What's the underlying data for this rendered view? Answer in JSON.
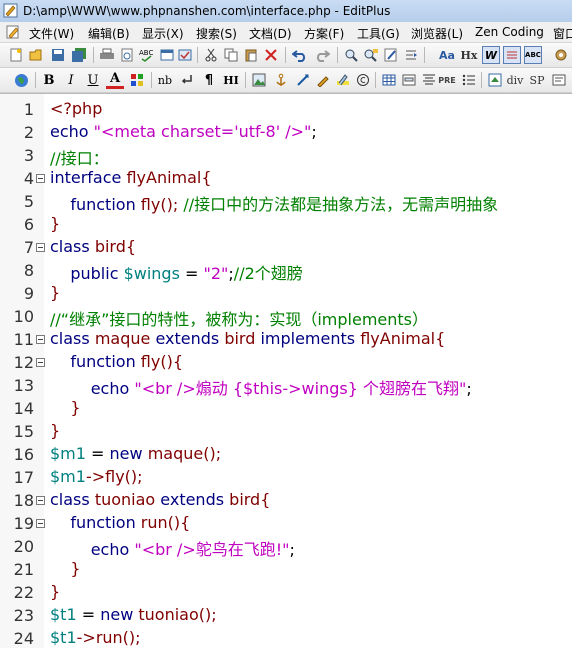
{
  "window": {
    "title": "D:\\amp\\WWW\\www.phpnanshen.com\\interface.php - EditPlus"
  },
  "menu": [
    "文件(W)",
    "编辑(B)",
    "显示(X)",
    "搜索(S)",
    "文档(D)",
    "方案(F)",
    "工具(G)",
    "浏览器(L)",
    "Zen Coding",
    "窗口"
  ],
  "toolbar2_labels": {
    "bold": "B",
    "italic": "I",
    "underline": "U",
    "font": "A",
    "nb": "nb",
    "para": "¶",
    "hi": "HI",
    "hx": "Hx",
    "pre": "PRE",
    "div": "div",
    "sp": "SP"
  },
  "colors": {
    "keyword": "#000080",
    "string": "#c000c0",
    "comment": "#008000",
    "variable": "#008080",
    "identifier": "#800000"
  },
  "code_lines": [
    {
      "n": "1",
      "fold": false,
      "indent": "",
      "tokens": [
        {
          "t": "<?php",
          "c": "p"
        }
      ]
    },
    {
      "n": "2",
      "fold": false,
      "indent": "",
      "tokens": [
        {
          "t": "echo ",
          "c": "k"
        },
        {
          "t": "\"<meta charset='utf-8' />\"",
          "c": "s"
        },
        {
          "t": ";",
          "c": "d"
        }
      ]
    },
    {
      "n": "3",
      "fold": false,
      "indent": "",
      "tokens": [
        {
          "t": "//接口：",
          "c": "c"
        }
      ]
    },
    {
      "n": "4",
      "fold": true,
      "indent": "",
      "tokens": [
        {
          "t": "interface ",
          "c": "k"
        },
        {
          "t": "flyAnimal{",
          "c": "p"
        }
      ]
    },
    {
      "n": "5",
      "fold": false,
      "indent": "    ",
      "tokens": [
        {
          "t": "function ",
          "c": "k"
        },
        {
          "t": "fly(); ",
          "c": "p"
        },
        {
          "t": "//接口中的方法都是抽象方法，无需声明抽象",
          "c": "c"
        }
      ]
    },
    {
      "n": "6",
      "fold": false,
      "indent": "",
      "tokens": [
        {
          "t": "}",
          "c": "p"
        }
      ]
    },
    {
      "n": "7",
      "fold": true,
      "indent": "",
      "tokens": [
        {
          "t": "class ",
          "c": "k"
        },
        {
          "t": "bird{",
          "c": "p"
        }
      ]
    },
    {
      "n": "8",
      "fold": false,
      "indent": "    ",
      "tokens": [
        {
          "t": "public ",
          "c": "k"
        },
        {
          "t": "$wings",
          "c": "v"
        },
        {
          "t": " = ",
          "c": "d"
        },
        {
          "t": "\"2\"",
          "c": "s"
        },
        {
          "t": ";",
          "c": "d"
        },
        {
          "t": "//2个翅膀",
          "c": "c"
        }
      ]
    },
    {
      "n": "9",
      "fold": false,
      "indent": "",
      "tokens": [
        {
          "t": "}",
          "c": "p"
        }
      ]
    },
    {
      "n": "10",
      "fold": false,
      "indent": "",
      "tokens": [
        {
          "t": "//“继承”接口的特性，被称为：实现（implements）",
          "c": "c"
        }
      ]
    },
    {
      "n": "11",
      "fold": true,
      "indent": "",
      "tokens": [
        {
          "t": "class ",
          "c": "k"
        },
        {
          "t": "maque ",
          "c": "p"
        },
        {
          "t": "extends ",
          "c": "k"
        },
        {
          "t": "bird ",
          "c": "p"
        },
        {
          "t": "implements ",
          "c": "k"
        },
        {
          "t": "flyAnimal{",
          "c": "p"
        }
      ]
    },
    {
      "n": "12",
      "fold": true,
      "indent": "    ",
      "tokens": [
        {
          "t": "function ",
          "c": "k"
        },
        {
          "t": "fly(){",
          "c": "p"
        }
      ]
    },
    {
      "n": "13",
      "fold": false,
      "indent": "        ",
      "tokens": [
        {
          "t": "echo ",
          "c": "k"
        },
        {
          "t": "\"<br />煽动 {$this->wings} 个翅膀在飞翔\"",
          "c": "s"
        },
        {
          "t": ";",
          "c": "d"
        }
      ]
    },
    {
      "n": "14",
      "fold": false,
      "indent": "    ",
      "tokens": [
        {
          "t": "}",
          "c": "p"
        }
      ]
    },
    {
      "n": "15",
      "fold": false,
      "indent": "",
      "tokens": [
        {
          "t": "}",
          "c": "p"
        }
      ]
    },
    {
      "n": "16",
      "fold": false,
      "indent": "",
      "tokens": [
        {
          "t": "$m1",
          "c": "v"
        },
        {
          "t": " = ",
          "c": "d"
        },
        {
          "t": "new ",
          "c": "k"
        },
        {
          "t": "maque();",
          "c": "p"
        }
      ]
    },
    {
      "n": "17",
      "fold": false,
      "indent": "",
      "tokens": [
        {
          "t": "$m1",
          "c": "v"
        },
        {
          "t": "->fly();",
          "c": "p"
        }
      ]
    },
    {
      "n": "18",
      "fold": true,
      "indent": "",
      "tokens": [
        {
          "t": "class ",
          "c": "k"
        },
        {
          "t": "tuoniao ",
          "c": "p"
        },
        {
          "t": "extends ",
          "c": "k"
        },
        {
          "t": "bird{",
          "c": "p"
        }
      ]
    },
    {
      "n": "19",
      "fold": true,
      "indent": "    ",
      "tokens": [
        {
          "t": "function ",
          "c": "k"
        },
        {
          "t": "run(){",
          "c": "p"
        }
      ]
    },
    {
      "n": "20",
      "fold": false,
      "indent": "        ",
      "tokens": [
        {
          "t": "echo ",
          "c": "k"
        },
        {
          "t": "\"<br />鸵鸟在飞跑!\"",
          "c": "s"
        },
        {
          "t": ";",
          "c": "d"
        }
      ]
    },
    {
      "n": "21",
      "fold": false,
      "indent": "    ",
      "tokens": [
        {
          "t": "}",
          "c": "p"
        }
      ]
    },
    {
      "n": "22",
      "fold": false,
      "indent": "",
      "tokens": [
        {
          "t": "}",
          "c": "p"
        }
      ]
    },
    {
      "n": "23",
      "fold": false,
      "indent": "",
      "tokens": [
        {
          "t": "$t1",
          "c": "v"
        },
        {
          "t": " = ",
          "c": "d"
        },
        {
          "t": "new ",
          "c": "k"
        },
        {
          "t": "tuoniao();",
          "c": "p"
        }
      ]
    },
    {
      "n": "24",
      "fold": false,
      "indent": "",
      "tokens": [
        {
          "t": "$t1",
          "c": "v"
        },
        {
          "t": "->run();",
          "c": "p"
        }
      ]
    }
  ]
}
